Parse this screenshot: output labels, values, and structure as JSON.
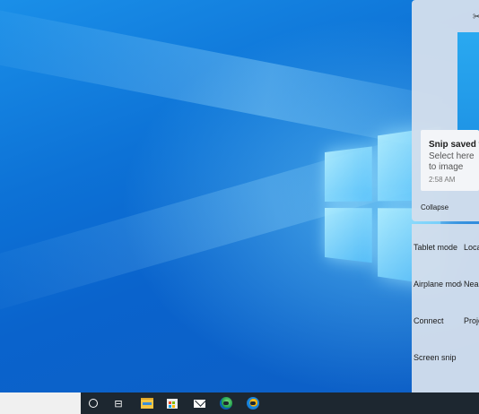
{
  "notification": {
    "title": "Snip saved to",
    "body": "Select here to image",
    "time": "2:58 AM",
    "collapse_label": "Collapse",
    "app_icon": "snip-sketch-icon"
  },
  "quick_actions": [
    {
      "label": "Tablet mode",
      "icon": "tablet-mode-icon"
    },
    {
      "label": "Loca",
      "icon": "location-icon"
    },
    {
      "label": "Airplane mode",
      "icon": "airplane-icon"
    },
    {
      "label": "Near",
      "icon": "nearby-sharing-icon"
    },
    {
      "label": "Connect",
      "icon": "connect-icon"
    },
    {
      "label": "Proje",
      "icon": "project-icon"
    },
    {
      "label": "Screen snip",
      "icon": "screen-snip-icon"
    }
  ],
  "taskbar": {
    "items": [
      {
        "name": "cortana-icon"
      },
      {
        "name": "task-view-icon",
        "glyph": "⊟"
      },
      {
        "name": "file-explorer-icon"
      },
      {
        "name": "microsoft-store-icon"
      },
      {
        "name": "mail-icon"
      },
      {
        "name": "edge-beta-icon"
      },
      {
        "name": "edge-canary-icon"
      }
    ]
  },
  "colors": {
    "desktop": "#0d72d6",
    "taskbar": "#1d2730",
    "panel": "#d2deec"
  }
}
